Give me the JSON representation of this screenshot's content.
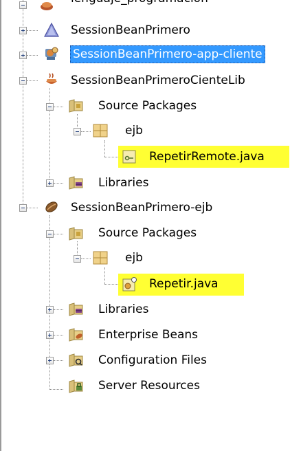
{
  "tree": {
    "nodes": [
      {
        "label": "lenguaje_programacion",
        "icon": "java-project-icon",
        "expander": "minus"
      },
      {
        "label": "SessionBeanPrimero",
        "icon": "ejb-module-icon",
        "expander": "plus"
      },
      {
        "label": "SessionBeanPrimero-app-cliente",
        "icon": "app-client-project-icon",
        "expander": "plus",
        "selected": true
      },
      {
        "label": "SessionBeanPrimeroCienteLib",
        "icon": "java-library-project-icon",
        "expander": "minus"
      },
      {
        "label": "Source Packages",
        "icon": "source-packages-folder-icon",
        "expander": "minus"
      },
      {
        "label": "ejb",
        "icon": "package-icon",
        "expander": "minus"
      },
      {
        "label": "RepetirRemote.java",
        "icon": "java-interface-file-icon",
        "highlighted": true
      },
      {
        "label": "Libraries",
        "icon": "libraries-folder-icon",
        "expander": "plus"
      },
      {
        "label": "SessionBeanPrimero-ejb",
        "icon": "ejb-bean-project-icon",
        "expander": "minus"
      },
      {
        "label": "Source Packages",
        "icon": "source-packages-folder-icon",
        "expander": "minus"
      },
      {
        "label": "ejb",
        "icon": "package-icon",
        "expander": "minus"
      },
      {
        "label": "Repetir.java",
        "icon": "session-bean-file-icon",
        "highlighted": true
      },
      {
        "label": "Libraries",
        "icon": "libraries-folder-icon",
        "expander": "plus"
      },
      {
        "label": "Enterprise Beans",
        "icon": "enterprise-beans-folder-icon",
        "expander": "plus"
      },
      {
        "label": "Configuration Files",
        "icon": "configuration-files-folder-icon",
        "expander": "plus"
      },
      {
        "label": "Server Resources",
        "icon": "server-resources-folder-icon"
      }
    ]
  },
  "colors": {
    "selection": "#3399ff",
    "highlight": "#ffff33",
    "connector": "#8a8a8a"
  }
}
